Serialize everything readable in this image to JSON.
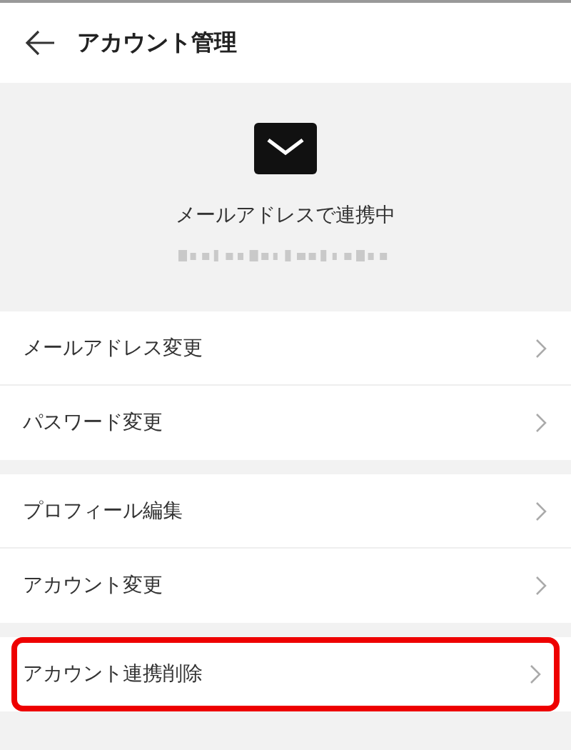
{
  "header": {
    "title": "アカウント管理"
  },
  "account": {
    "status": "メールアドレスで連携中"
  },
  "groups": [
    {
      "items": [
        {
          "label": "メールアドレス変更",
          "highlighted": false
        },
        {
          "label": "パスワード変更",
          "highlighted": false
        }
      ]
    },
    {
      "items": [
        {
          "label": "プロフィール編集",
          "highlighted": false
        },
        {
          "label": "アカウント変更",
          "highlighted": false
        }
      ]
    },
    {
      "items": [
        {
          "label": "アカウント連携削除",
          "highlighted": true
        }
      ]
    }
  ]
}
